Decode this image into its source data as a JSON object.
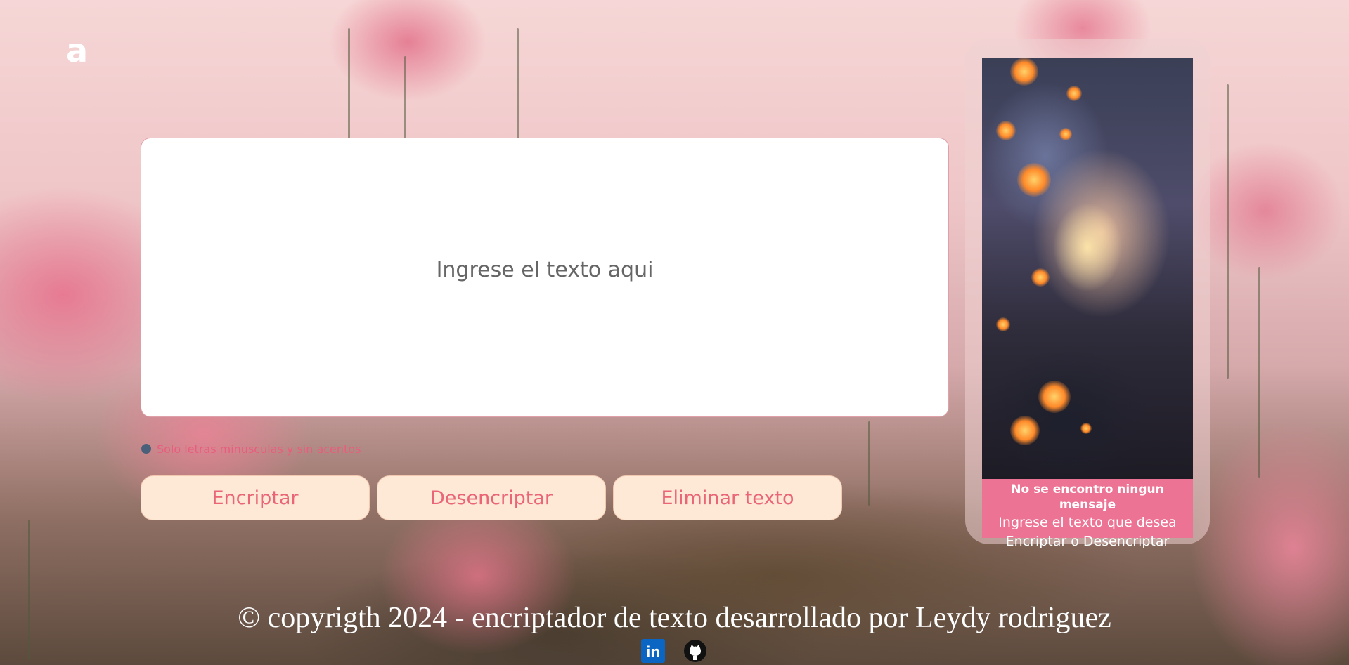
{
  "brand": {
    "logo_text": "a"
  },
  "editor": {
    "placeholder": "Ingrese el texto aqui"
  },
  "hint": {
    "text": "Solo letras minusculas y sin acentos"
  },
  "buttons": {
    "encrypt_label": "Encriptar",
    "decrypt_label": "Desencriptar",
    "clear_label": "Eliminar texto"
  },
  "result_panel": {
    "title": "No se encontro ningun mensaje",
    "line1": "Ingrese el texto que desea",
    "line2": "Encriptar o Desencriptar"
  },
  "footer": {
    "copyright": "© copyrigth 2024 - encriptador de texto desarrollado por Leydy rodriguez"
  },
  "social": {
    "linkedin_text": "in"
  },
  "colors": {
    "accent": "#ea6677",
    "button_bg": "#fde9d6",
    "message_bg": "#ec7393",
    "hint": "#e85d7d"
  },
  "icons": [
    "info-icon",
    "linkedin-icon",
    "github-icon"
  ]
}
